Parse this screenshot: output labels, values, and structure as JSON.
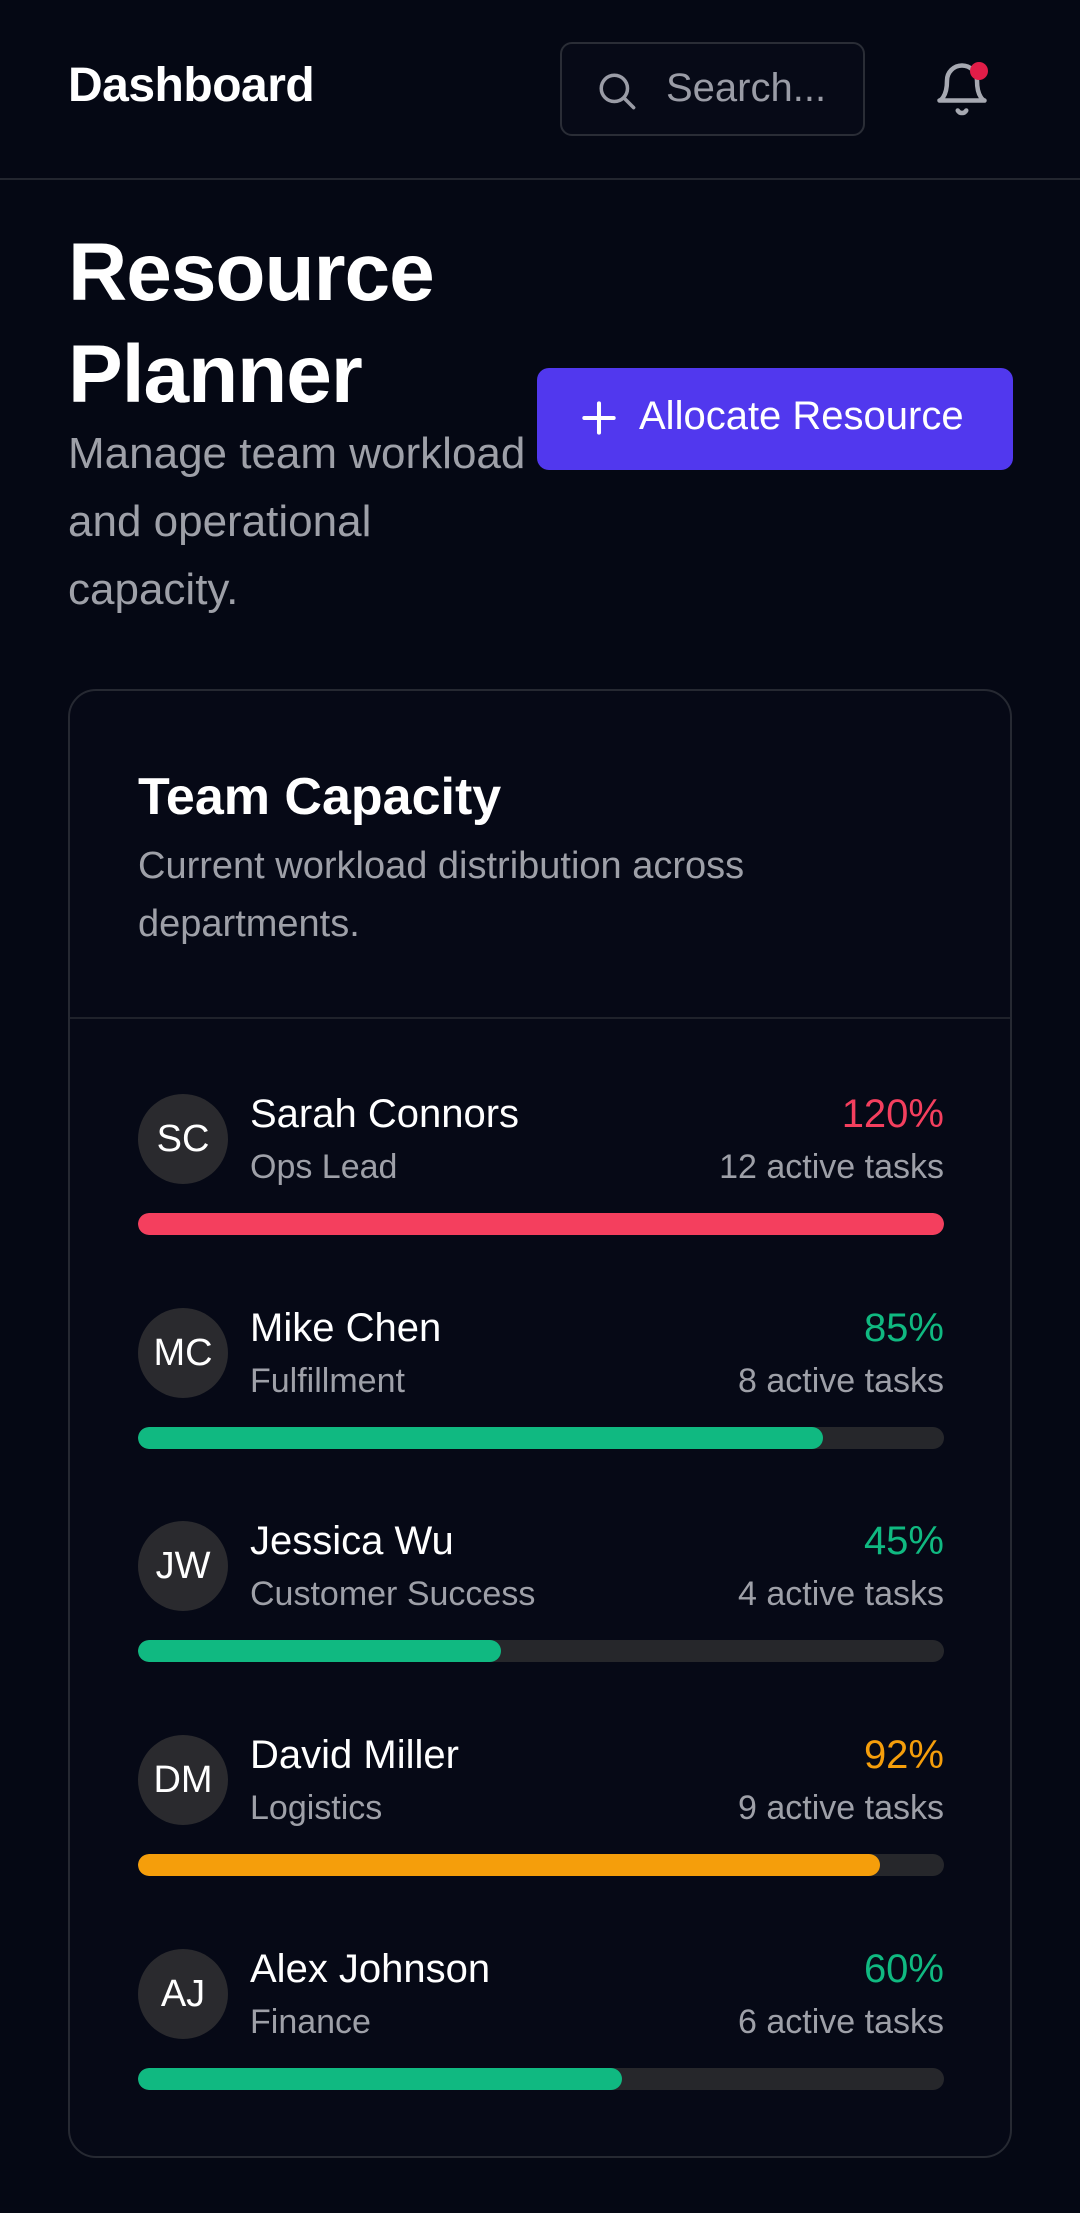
{
  "header": {
    "brand": "Dashboard",
    "search_placeholder": "Search...",
    "notification_dot_color": "#e11d48"
  },
  "hero": {
    "title": "Resource Planner",
    "subtitle": "Manage team workload and operational capacity.",
    "cta_label": "Allocate Resource",
    "cta_color": "#5138ee"
  },
  "capacity": {
    "title": "Team Capacity",
    "subtitle": "Current workload distribution across departments.",
    "members": [
      {
        "initials": "SC",
        "name": "Sarah Connors",
        "role": "Ops Lead",
        "percent_label": "120%",
        "tasks": "12 active tasks",
        "fill": 1.0,
        "color": "#f43f5e"
      },
      {
        "initials": "MC",
        "name": "Mike Chen",
        "role": "Fulfillment",
        "percent_label": "85%",
        "tasks": "8 active tasks",
        "fill": 0.85,
        "color": "#10b981"
      },
      {
        "initials": "JW",
        "name": "Jessica Wu",
        "role": "Customer Success",
        "percent_label": "45%",
        "tasks": "4 active tasks",
        "fill": 0.45,
        "color": "#10b981"
      },
      {
        "initials": "DM",
        "name": "David Miller",
        "role": "Logistics",
        "percent_label": "92%",
        "tasks": "9 active tasks",
        "fill": 0.92,
        "color": "#f59e0b"
      },
      {
        "initials": "AJ",
        "name": "Alex Johnson",
        "role": "Finance",
        "percent_label": "60%",
        "tasks": "6 active tasks",
        "fill": 0.6,
        "color": "#10b981"
      }
    ]
  }
}
